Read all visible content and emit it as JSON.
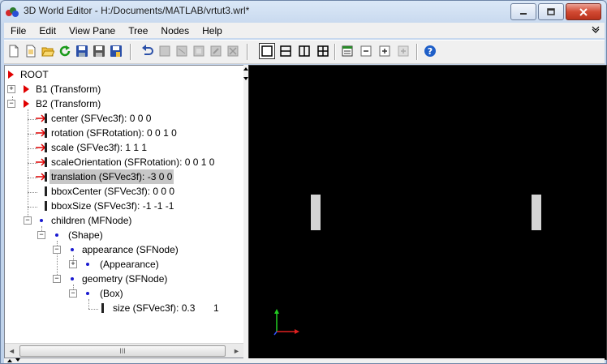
{
  "window": {
    "title": "3D World Editor - H:/Documents/MATLAB/vrtut3.wrl*",
    "controls": [
      "minimize-icon",
      "maximize-icon",
      "close-icon"
    ]
  },
  "menu": {
    "items": [
      "File",
      "Edit",
      "View Pane",
      "Tree",
      "Nodes",
      "Help"
    ],
    "overflow_icon": "chevron-double-icon"
  },
  "toolbar": {
    "buttons": [
      "new-icon",
      "new-from-template-icon",
      "open-icon",
      "reload-icon",
      "save-icon",
      "save-as-icon",
      "export-icon",
      "undo-icon",
      "cut-icon",
      "copy-icon",
      "paste-icon",
      "paste-special-icon",
      "delete-icon",
      "single-pane-icon",
      "split-horizontal-icon",
      "split-vertical-icon",
      "four-pane-icon",
      "toggle-tree-icon",
      "zoom-out-icon",
      "zoom-in-icon",
      "add-icon",
      "help-icon"
    ]
  },
  "tree": {
    "root": "ROOT",
    "b1": "B1 (Transform)",
    "b2": "B2 (Transform)",
    "center": "center (SFVec3f): 0  0  0",
    "rotation": "rotation (SFRotation): 0  0  1  0",
    "scale": "scale (SFVec3f): 1  1  1",
    "scaleOrientation": "scaleOrientation (SFRotation): 0  0  1  0",
    "translation": "translation (SFVec3f): -3  0  0",
    "bboxCenter": "bboxCenter (SFVec3f): 0  0  0",
    "bboxSize": "bboxSize (SFVec3f): -1  -1  -1",
    "children": "children (MFNode)",
    "shape": "(Shape)",
    "appearance": "appearance (SFNode)",
    "appearance_child": "(Appearance)",
    "geometry": "geometry (SFNode)",
    "box": "(Box)",
    "size": "size (SFVec3f): 0.3",
    "size_extra": "1"
  },
  "scroll": {
    "left": "◄",
    "right": "►",
    "grip": "III"
  },
  "colors": {
    "accent_red": "#e00000",
    "node_blue": "#1a1ad0",
    "selection": "#c7c7c7",
    "viewport_bg": "#000000"
  }
}
